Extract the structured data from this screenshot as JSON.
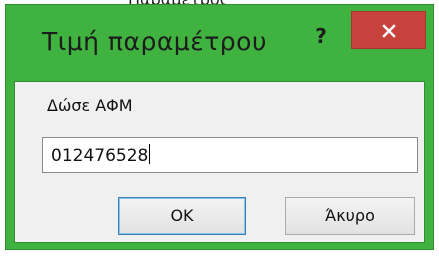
{
  "background": {
    "partial_text": "Παράμετρος"
  },
  "dialog": {
    "title": "Τιμή παραμέτρου",
    "help_label": "?",
    "close_icon": "close-icon",
    "prompt": "Δώσε ΑΦΜ",
    "input_value": "012476528",
    "ok_label": "OK",
    "cancel_label": "Άκυρο"
  },
  "colors": {
    "title_bar": "#3fb23f",
    "close_button": "#c8423d",
    "client_bg": "#f0f0f0"
  }
}
